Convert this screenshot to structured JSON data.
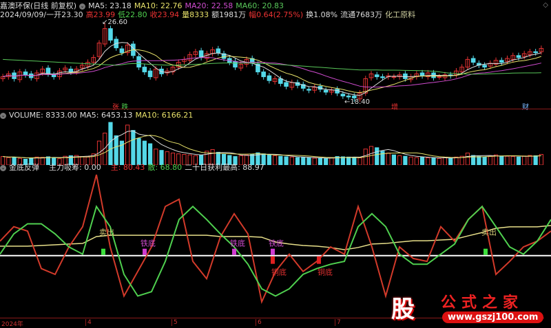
{
  "header": {
    "stock_name": "嘉澳环保(日线 前复权)",
    "ma5": "MA5: 23.18",
    "ma10": "MA10: 22.76",
    "ma20": "MA20: 22.58",
    "ma60": "MA60: 20.83",
    "date": "2024/09/09/一",
    "open": "开23.30",
    "high": "高23.99",
    "low": "低22.80",
    "close": "收23.94",
    "volume": "量8333",
    "amount": "额1981万",
    "change": "幅0.64(2.75%)",
    "turnover": "换1.08%",
    "float": "流通7683万",
    "industry": "化工原料"
  },
  "price_panel": {
    "high_label": "26.60",
    "low_label": "18.40",
    "markers": [
      "张",
      "跌",
      "增",
      "财"
    ],
    "closes": [
      21.0,
      21.3,
      20.8,
      21.5,
      21.2,
      20.9,
      21.4,
      21.8,
      21.3,
      21.0,
      21.6,
      21.9,
      21.5,
      21.8,
      22.2,
      22.5,
      23.0,
      24.5,
      26.0,
      24.8,
      24.0,
      23.5,
      24.3,
      23.2,
      22.0,
      21.5,
      21.0,
      21.8,
      21.3,
      21.6,
      22.0,
      22.5,
      22.8,
      23.3,
      23.6,
      23.0,
      23.4,
      23.8,
      23.5,
      22.9,
      22.5,
      22.0,
      22.3,
      22.8,
      22.4,
      21.5,
      21.0,
      20.6,
      20.8,
      20.3,
      20.0,
      20.4,
      20.1,
      19.8,
      19.6,
      19.9,
      19.7,
      19.4,
      19.6,
      19.3,
      19.0,
      18.9,
      18.8,
      19.3,
      20.8,
      21.3,
      21.0,
      20.9,
      21.1,
      21.0,
      21.2,
      20.8,
      21.0,
      21.3,
      21.1,
      21.4,
      20.9,
      21.0,
      21.2,
      21.1,
      21.6,
      22.0,
      22.8,
      22.5,
      22.2,
      22.0,
      22.4,
      22.7,
      22.5,
      22.9,
      23.2,
      23.0,
      23.4,
      23.6,
      23.5,
      23.94
    ]
  },
  "volume_panel": {
    "title": "VOLUME: 8333.00",
    "ma5": "MA5: 6453.13",
    "ma10": "MA10: 6166.21",
    "values": [
      3200,
      2800,
      3000,
      2500,
      2200,
      2600,
      3000,
      2900,
      3100,
      2700,
      2400,
      3300,
      3500,
      3600,
      3200,
      3000,
      4200,
      9000,
      12000,
      16000,
      11000,
      9000,
      15000,
      13000,
      10000,
      9000,
      8000,
      6000,
      5500,
      5000,
      4500,
      4200,
      4000,
      3800,
      3500,
      3600,
      5200,
      5800,
      4800,
      4000,
      3600,
      3200,
      3500,
      3800,
      4000,
      4600,
      4200,
      3800,
      3500,
      3300,
      3100,
      3000,
      2800,
      2900,
      2700,
      2600,
      2500,
      2400,
      2800,
      3200,
      3100,
      3000,
      2900,
      2700,
      6000,
      7000,
      6500,
      5200,
      4500,
      3800,
      3500,
      3300,
      3000,
      2800,
      2900,
      2700,
      2600,
      2500,
      2800,
      2600,
      3000,
      3300,
      4500,
      3600,
      3200,
      3100,
      3500,
      3800,
      3400,
      3300,
      3200,
      3000,
      3400,
      3600,
      3500,
      4000
    ]
  },
  "indicator_panel": {
    "title": "金底反弹",
    "absorb": "主力吸筹: 0.00",
    "main": "主: 80.43",
    "retail": "散: 68.80",
    "max20": "二十日获利最高: 88.97",
    "sell_label": "卖出",
    "iron_label": "铁底",
    "copper_label": "铜底",
    "red_line": [
      53,
      63,
      60,
      34,
      30,
      49,
      63,
      99,
      49,
      15,
      32,
      49,
      77,
      82,
      39,
      27,
      56,
      72,
      58,
      11,
      32,
      44,
      32,
      39,
      49,
      44,
      77,
      49,
      15,
      49,
      41,
      39,
      63,
      53,
      68,
      77,
      30,
      39,
      49,
      53,
      60
    ],
    "green_line": [
      44,
      58,
      65,
      65,
      58,
      49,
      44,
      77,
      63,
      30,
      15,
      18,
      39,
      68,
      77,
      68,
      58,
      49,
      37,
      20,
      15,
      20,
      30,
      34,
      37,
      39,
      63,
      72,
      63,
      44,
      37,
      37,
      44,
      51,
      68,
      77,
      63,
      49,
      44,
      53,
      68
    ],
    "yellow_line": [
      49.5,
      49.5,
      49.5,
      50,
      50.5,
      51,
      51.4,
      56.2,
      57.1,
      57.1,
      57.1,
      57.1,
      57.1,
      57.1,
      57.1,
      57.1,
      56.2,
      56.2,
      56.2,
      55.7,
      52.4,
      51,
      50,
      49.5,
      48.6,
      47.1,
      48.6,
      51,
      51.4,
      52.4,
      53.3,
      53.3,
      53.8,
      54.3,
      56.7,
      59,
      61.9,
      62.9,
      62.9,
      62.9,
      63.8
    ]
  },
  "axis": {
    "year": "2024年",
    "months": [
      "4",
      "5",
      "6",
      "7"
    ]
  },
  "logo": {
    "gu": "股",
    "title": "公式之家",
    "url": "www.gszj100.com"
  },
  "colors": {
    "up": "#e33333",
    "down": "#54d8e8",
    "ma5": "#dddddd",
    "ma10": "#e8e26a",
    "ma20": "#d04cd0",
    "ma60": "#59c85a"
  }
}
